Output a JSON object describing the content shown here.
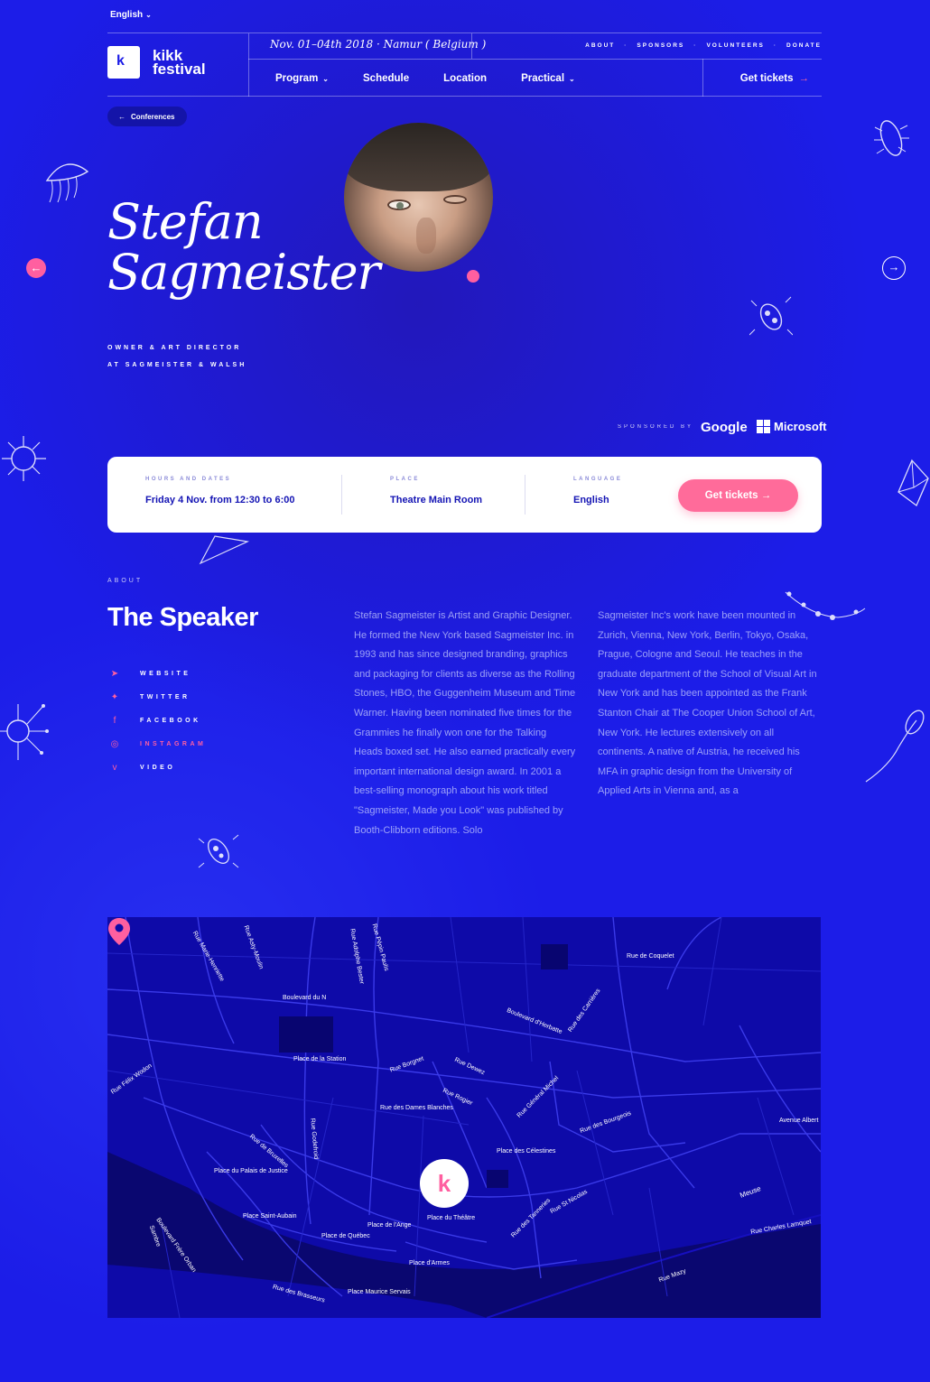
{
  "language": "English",
  "header": {
    "logo_line1": "kikk",
    "logo_line2": "festival",
    "logo_mark": "k",
    "dates": "Nov. 01–04th 2018 · Namur ( Belgium )",
    "topnav": [
      "ABOUT",
      "SPONSORS",
      "VOLUNTEERS",
      "DONATE"
    ],
    "mainnav": [
      {
        "label": "Program",
        "dropdown": true
      },
      {
        "label": "Schedule",
        "dropdown": false
      },
      {
        "label": "Location",
        "dropdown": false
      },
      {
        "label": "Practical",
        "dropdown": true
      }
    ],
    "get_tickets": "Get tickets"
  },
  "back_link": "Conferences",
  "speaker": {
    "first_name": "Stefan",
    "last_name": "Sagmeister",
    "role_line1": "OWNER & ART DIRECTOR",
    "role_line2": "AT SAGMEISTER & WALSH"
  },
  "sponsors": {
    "label": "SPONSORED BY",
    "items": [
      "Google",
      "Microsoft"
    ]
  },
  "info_card": {
    "hours_label": "HOURS AND DATES",
    "hours_value": "Friday 4 Nov. from 12:30 to 6:00",
    "place_label": "PLACE",
    "place_value": "Theatre Main Room",
    "language_label": "LANGUAGE",
    "language_value": "English",
    "cta": "Get tickets"
  },
  "about": {
    "label": "ABOUT",
    "title": "The Speaker",
    "links": [
      {
        "icon": "cursor-icon",
        "label": "WEBSITE"
      },
      {
        "icon": "twitter-icon",
        "label": "TWITTER"
      },
      {
        "icon": "facebook-icon",
        "label": "FACEBOOK"
      },
      {
        "icon": "instagram-icon",
        "label": "INSTAGRAM"
      },
      {
        "icon": "vimeo-icon",
        "label": "VIDEO"
      }
    ],
    "bio_col1": "Stefan Sagmeister is Artist and Graphic Designer. He formed the New York based Sagmeister Inc. in 1993 and has since designed branding, graphics and packaging for clients as diverse as the Rolling Stones, HBO, the Guggenheim Museum and Time Warner. Having been nominated five times for the Grammies he finally won one for the Talking Heads boxed set. He also earned practically every important international design award. In 2001 a best-selling monograph about his work titled \"Sagmeister, Made you Look\" was published by Booth-Clibborn editions. Solo",
    "bio_col2": "Sagmeister Inc's work have been mounted in Zurich, Vienna, New York, Berlin, Tokyo, Osaka, Prague, Cologne and Seoul. He teaches in the graduate department of the School of Visual Art in New York and has been appointed as the Frank Stanton Chair at The Cooper Union School of Art, New York. He lectures extensively on all continents. A native of Austria, he received his MFA in graphic design from the University of Applied Arts in Vienna and, as a"
  },
  "map": {
    "labels": [
      "Boulevard du N",
      "Rue Asty-Moulin",
      "Rue Adolphe Bester",
      "Rue Pépin Paulis",
      "Rue Marie-Henriette",
      "Rue de Coquelet",
      "Boulevard d'Herbatte",
      "Rue des Carrières",
      "Place de la Station",
      "Rue Borgnet",
      "Rue Dewez",
      "Rue Godefroid",
      "Rue des Dames Blanches",
      "Rue Rogier",
      "Rue Général Michel",
      "Rue des Bourgeois",
      "Place des Célestines",
      "Rue Félix Wodon",
      "Rue de Bruxelles",
      "Place du Palais de Justice",
      "Place Saint-Aubain",
      "Place de Québec",
      "Place de l'Ange",
      "Place du Théâtre",
      "Place d'Armes",
      "Place Maurice Servais",
      "Rue des Brasseurs",
      "Rue St Nicolas",
      "Rue des Tanneries",
      "Meuse",
      "Sambre",
      "Avenue Albert",
      "Rue Charles Lamquet",
      "Rue Mazy",
      "Boulevard Frère Orban"
    ]
  },
  "colors": {
    "background": "#1a1ae6",
    "accent": "#ff6b9a",
    "map": "#0e0aa8"
  }
}
